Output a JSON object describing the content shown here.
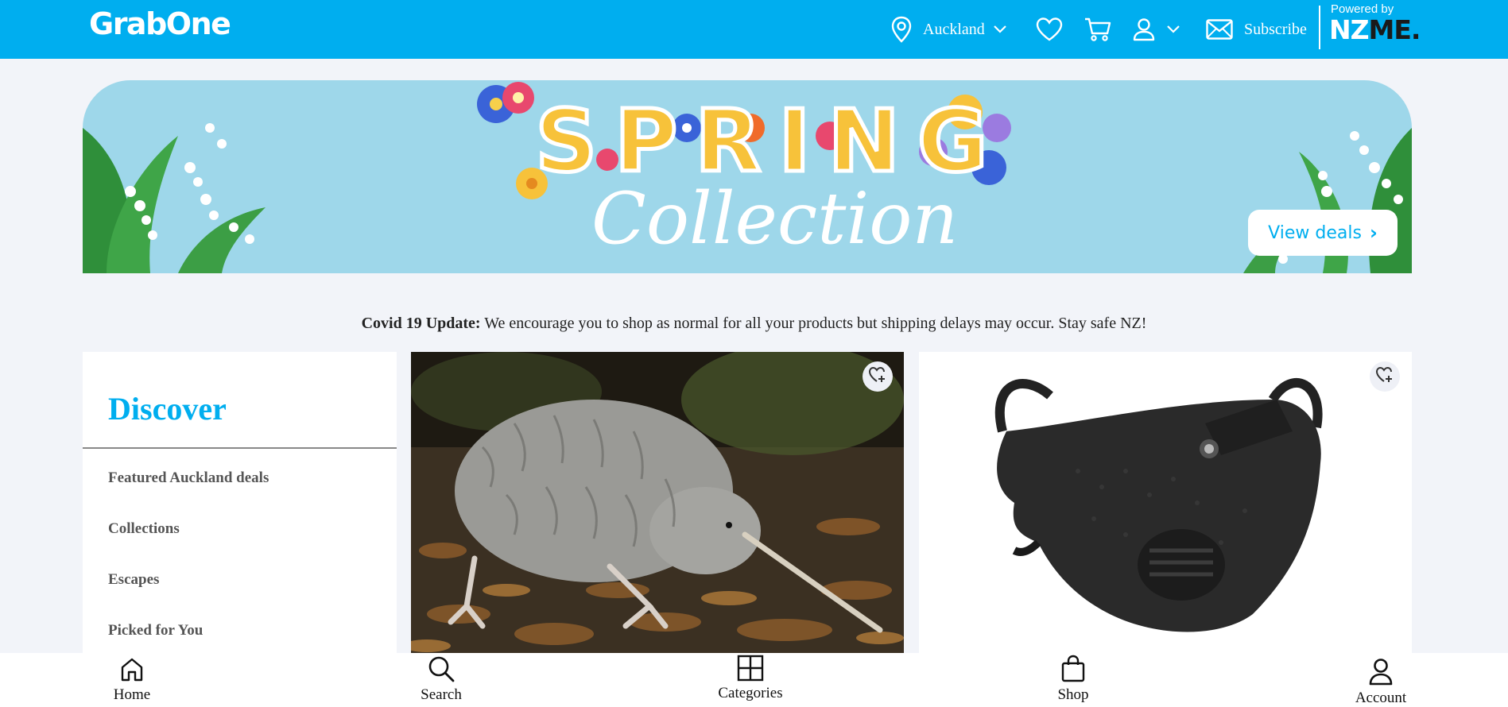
{
  "header": {
    "logo": "GrabOne",
    "location": "Auckland",
    "subscribe_label": "Subscribe",
    "powered_by": "Powered by",
    "partner_logo_nz": "NZ",
    "partner_logo_me": "ME.",
    "icons": [
      "location-pin-icon",
      "chevron-down-icon",
      "heart-icon",
      "cart-icon",
      "user-icon",
      "mail-icon"
    ]
  },
  "hero": {
    "title": "SPRING",
    "subtitle": "Collection",
    "cta_label": "View deals"
  },
  "notice": {
    "label": "Covid 19 Update:",
    "text": " We encourage you to shop as normal for all your products but shipping delays may occur. Stay safe NZ!"
  },
  "discover": {
    "title": "Discover",
    "items": [
      {
        "label": "Featured Auckland deals"
      },
      {
        "label": "Collections"
      },
      {
        "label": "Escapes"
      },
      {
        "label": "Picked for You"
      }
    ]
  },
  "products": [
    {
      "image": "kiwi-bird-photo"
    },
    {
      "image": "black-face-mask-photo"
    }
  ],
  "bottom_nav": {
    "items": [
      {
        "label": "Home",
        "icon": "home-icon"
      },
      {
        "label": "Search",
        "icon": "search-icon"
      },
      {
        "label": "Categories",
        "icon": "grid-icon"
      },
      {
        "label": "Shop",
        "icon": "shopping-bag-icon"
      },
      {
        "label": "Account",
        "icon": "user-icon"
      }
    ]
  },
  "colors": {
    "brand": "#00aeef",
    "background": "#f2f4f9",
    "hero_bg": "#9ed7ea"
  }
}
